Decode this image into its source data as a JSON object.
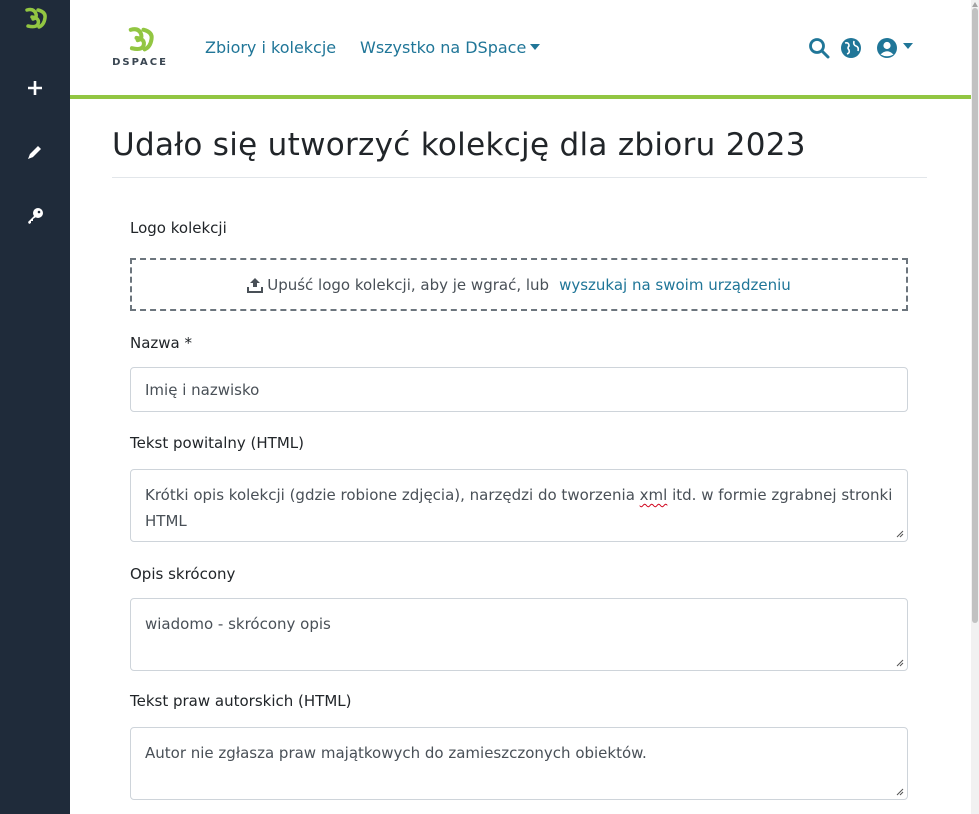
{
  "brand": {
    "name": "DSPACE"
  },
  "nav": {
    "communities": "Zbiory i kolekcje",
    "browse": "Wszystko na DSpace"
  },
  "page": {
    "title": "Udało się utworzyć kolekcję dla zbioru 2023"
  },
  "form": {
    "logo": {
      "label": "Logo kolekcji",
      "drop_text": "Upuść logo kolekcji, aby je wgrać, lub",
      "browse_link": "wyszukaj na swoim urządzeniu"
    },
    "name": {
      "label": "Nazwa *",
      "value": "Imię i nazwisko"
    },
    "intro": {
      "label": "Tekst powitalny (HTML)",
      "value_before": "Krótki opis kolekcji (gdzie robione zdjęcia), narzędzi do tworzenia ",
      "value_marked": "xml",
      "value_after": " itd. w formie zgrabnej stronki HTML"
    },
    "short_description": {
      "label": "Opis skrócony",
      "value": "wiadomo - skrócony opis"
    },
    "copyright": {
      "label": "Tekst praw autorskich (HTML)",
      "value": "Autor nie zgłasza praw majątkowych do zamieszczonych obiektów."
    }
  },
  "colors": {
    "sidebar": "#1f2b3a",
    "accent_green": "#92c642",
    "link": "#207698"
  },
  "icons": {
    "sidebar": [
      "dspace-logo-icon",
      "plus-icon",
      "pencil-icon",
      "key-icon"
    ],
    "header": [
      "search-icon",
      "globe-icon",
      "user-circle-icon"
    ]
  }
}
